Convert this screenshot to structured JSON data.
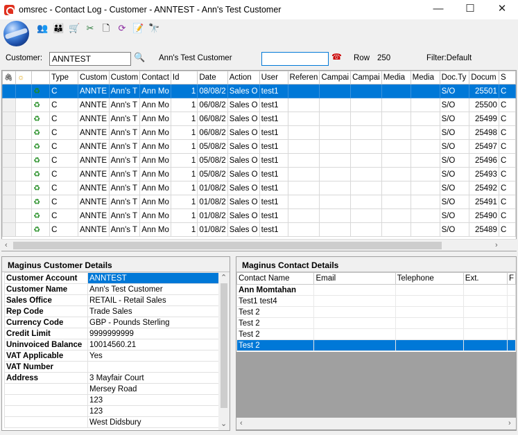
{
  "window": {
    "title": "omsrec - Contact Log - Customer - ANNTEST - Ann's Test Customer",
    "minimize": "—",
    "maximize": "☐",
    "close": "✕"
  },
  "toolbar": {
    "icons": [
      "users-icon",
      "user-group-icon",
      "cart-icon",
      "tools-icon",
      "document-icon",
      "refresh-icon",
      "notes-icon",
      "binoculars-icon"
    ]
  },
  "customer_bar": {
    "customer_label": "Customer:",
    "customer_value": "ANNTEST",
    "customer_name": "Ann's Test Customer",
    "contact_value": "",
    "row_label": "Row",
    "row_value": "250",
    "filter_text": "Filter:Default"
  },
  "grid": {
    "columns": [
      "",
      "",
      "",
      "Type",
      "Custom",
      "Custom",
      "Contact",
      "Id",
      "Date",
      "Action",
      "User",
      "Referen",
      "Campai",
      "Campai",
      "Media",
      "Media",
      "Doc.Ty",
      "Docum",
      "S"
    ],
    "rows": [
      {
        "type": "C",
        "cust": "ANNTE",
        "custname": "Ann's T",
        "contact": "Ann Mo",
        "id": "1",
        "date": "08/08/2",
        "action": "Sales O",
        "user": "test1",
        "doctype": "S/O",
        "doc": "25501",
        "s": "C"
      },
      {
        "type": "C",
        "cust": "ANNTE",
        "custname": "Ann's T",
        "contact": "Ann Mo",
        "id": "1",
        "date": "06/08/2",
        "action": "Sales O",
        "user": "test1",
        "doctype": "S/O",
        "doc": "25500",
        "s": "C"
      },
      {
        "type": "C",
        "cust": "ANNTE",
        "custname": "Ann's T",
        "contact": "Ann Mo",
        "id": "1",
        "date": "06/08/2",
        "action": "Sales O",
        "user": "test1",
        "doctype": "S/O",
        "doc": "25499",
        "s": "C"
      },
      {
        "type": "C",
        "cust": "ANNTE",
        "custname": "Ann's T",
        "contact": "Ann Mo",
        "id": "1",
        "date": "06/08/2",
        "action": "Sales O",
        "user": "test1",
        "doctype": "S/O",
        "doc": "25498",
        "s": "C"
      },
      {
        "type": "C",
        "cust": "ANNTE",
        "custname": "Ann's T",
        "contact": "Ann Mo",
        "id": "1",
        "date": "05/08/2",
        "action": "Sales O",
        "user": "test1",
        "doctype": "S/O",
        "doc": "25497",
        "s": "C"
      },
      {
        "type": "C",
        "cust": "ANNTE",
        "custname": "Ann's T",
        "contact": "Ann Mo",
        "id": "1",
        "date": "05/08/2",
        "action": "Sales O",
        "user": "test1",
        "doctype": "S/O",
        "doc": "25496",
        "s": "C"
      },
      {
        "type": "C",
        "cust": "ANNTE",
        "custname": "Ann's T",
        "contact": "Ann Mo",
        "id": "1",
        "date": "05/08/2",
        "action": "Sales O",
        "user": "test1",
        "doctype": "S/O",
        "doc": "25493",
        "s": "C"
      },
      {
        "type": "C",
        "cust": "ANNTE",
        "custname": "Ann's T",
        "contact": "Ann Mo",
        "id": "1",
        "date": "01/08/2",
        "action": "Sales O",
        "user": "test1",
        "doctype": "S/O",
        "doc": "25492",
        "s": "C"
      },
      {
        "type": "C",
        "cust": "ANNTE",
        "custname": "Ann's T",
        "contact": "Ann Mo",
        "id": "1",
        "date": "01/08/2",
        "action": "Sales O",
        "user": "test1",
        "doctype": "S/O",
        "doc": "25491",
        "s": "C"
      },
      {
        "type": "C",
        "cust": "ANNTE",
        "custname": "Ann's T",
        "contact": "Ann Mo",
        "id": "1",
        "date": "01/08/2",
        "action": "Sales O",
        "user": "test1",
        "doctype": "S/O",
        "doc": "25490",
        "s": "C"
      },
      {
        "type": "C",
        "cust": "ANNTE",
        "custname": "Ann's T",
        "contact": "Ann Mo",
        "id": "1",
        "date": "01/08/2",
        "action": "Sales O",
        "user": "test1",
        "doctype": "S/O",
        "doc": "25489",
        "s": "C"
      }
    ]
  },
  "customer_details": {
    "title": "Maginus Customer Details",
    "rows": [
      {
        "k": "Customer Account",
        "v": "ANNTEST"
      },
      {
        "k": "Customer Name",
        "v": "Ann's Test Customer"
      },
      {
        "k": "Sales Office",
        "v": "RETAIL - Retail Sales"
      },
      {
        "k": "Rep Code",
        "v": "Trade Sales"
      },
      {
        "k": "Currency Code",
        "v": "GBP - Pounds Sterling"
      },
      {
        "k": "Credit Limit",
        "v": "9999999999"
      },
      {
        "k": "Uninvoiced Balance",
        "v": "10014560.21"
      },
      {
        "k": "VAT Applicable",
        "v": "Yes"
      },
      {
        "k": "VAT Number",
        "v": ""
      },
      {
        "k": "Address",
        "v": "3 Mayfair Court"
      },
      {
        "k": "",
        "v": "Mersey Road"
      },
      {
        "k": "",
        "v": "123"
      },
      {
        "k": "",
        "v": "123"
      },
      {
        "k": "",
        "v": "West Didsbury"
      }
    ]
  },
  "contact_details": {
    "title": "Maginus Contact Details",
    "columns": [
      "Contact Name",
      "Email",
      "Telephone",
      "Ext.",
      "F"
    ],
    "rows": [
      "Ann Momtahan",
      "Test1 test4",
      "Test 2",
      "Test 2",
      "Test 2",
      "Test 2"
    ]
  },
  "colors": {
    "selection": "#0078d7",
    "window_bg": "#f0f0f0"
  }
}
